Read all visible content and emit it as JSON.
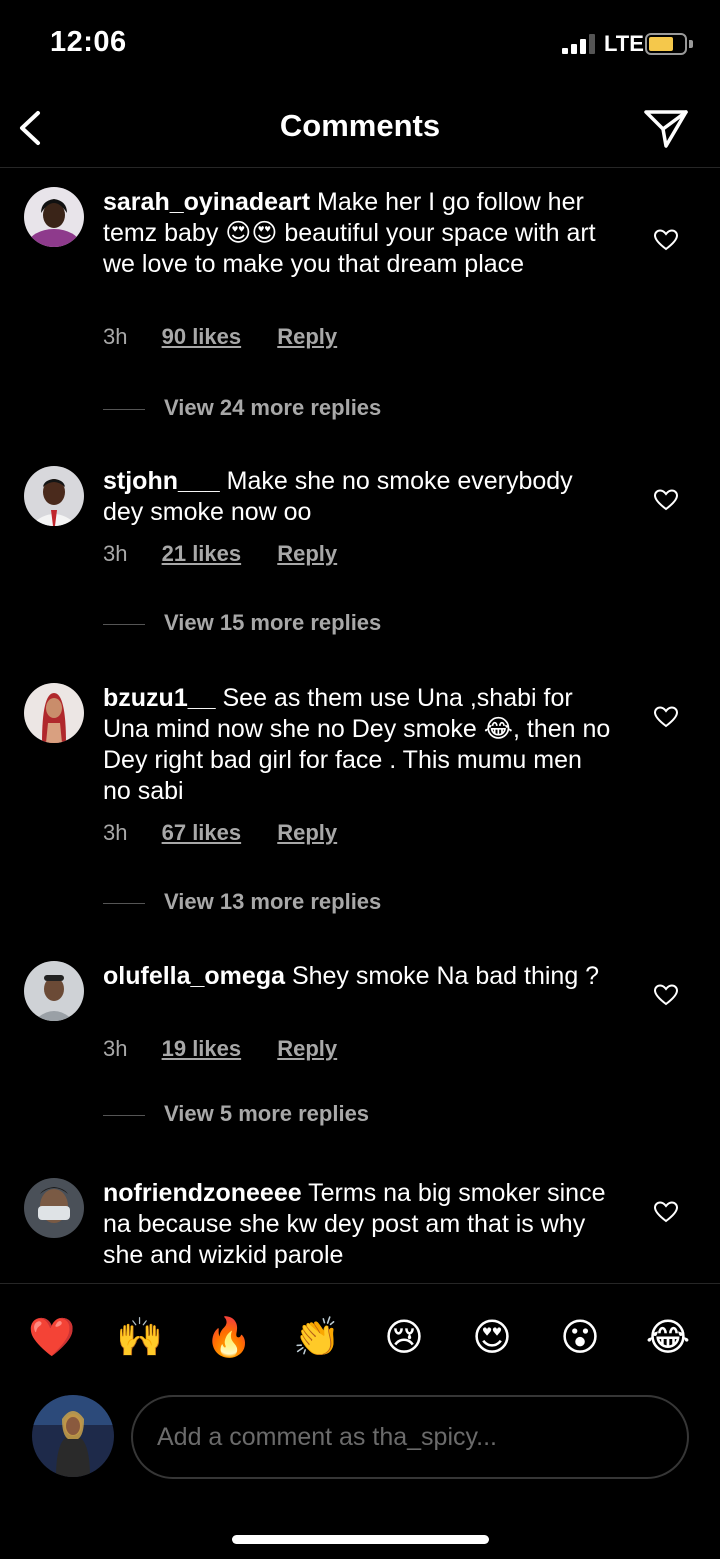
{
  "status_bar": {
    "time": "12:06",
    "network": "LTE",
    "battery_color": "#f5c84b"
  },
  "header": {
    "title": "Comments",
    "back_icon": "chevron-left-icon",
    "send_icon": "paper-plane-icon"
  },
  "comments": [
    {
      "username": "sarah_oyinadeart",
      "text": "Make her I go follow her temz baby 😍😍 beautiful your space with art we love to make you that dream place",
      "time": "3h",
      "likes": "90 likes",
      "reply": "Reply",
      "view_replies": "View 24 more replies"
    },
    {
      "username": "stjohn___",
      "text": "Make she no smoke everybody dey smoke now oo",
      "time": "3h",
      "likes": "21 likes",
      "reply": "Reply",
      "view_replies": "View 15 more replies"
    },
    {
      "username": "bzuzu1__",
      "text": "See as them use Una ,shabi for Una mind now she no Dey smoke 😂, then no Dey right bad girl for face . This mumu men no sabi",
      "time": "3h",
      "likes": "67 likes",
      "reply": "Reply",
      "view_replies": "View 13 more replies"
    },
    {
      "username": "olufella_omega",
      "text": "Shey smoke Na bad thing ?",
      "time": "3h",
      "likes": "19 likes",
      "reply": "Reply",
      "view_replies": "View 5 more replies"
    },
    {
      "username": "nofriendzoneeee",
      "text": "Terms na big smoker since na because she kw dey post am that is why she and wizkid parole"
    }
  ],
  "emoji_bar": [
    "❤️",
    "🙌",
    "🔥",
    "👏",
    "😢",
    "😍",
    "😮",
    "😂"
  ],
  "compose": {
    "placeholder": "Add a comment as tha_spicy..."
  }
}
